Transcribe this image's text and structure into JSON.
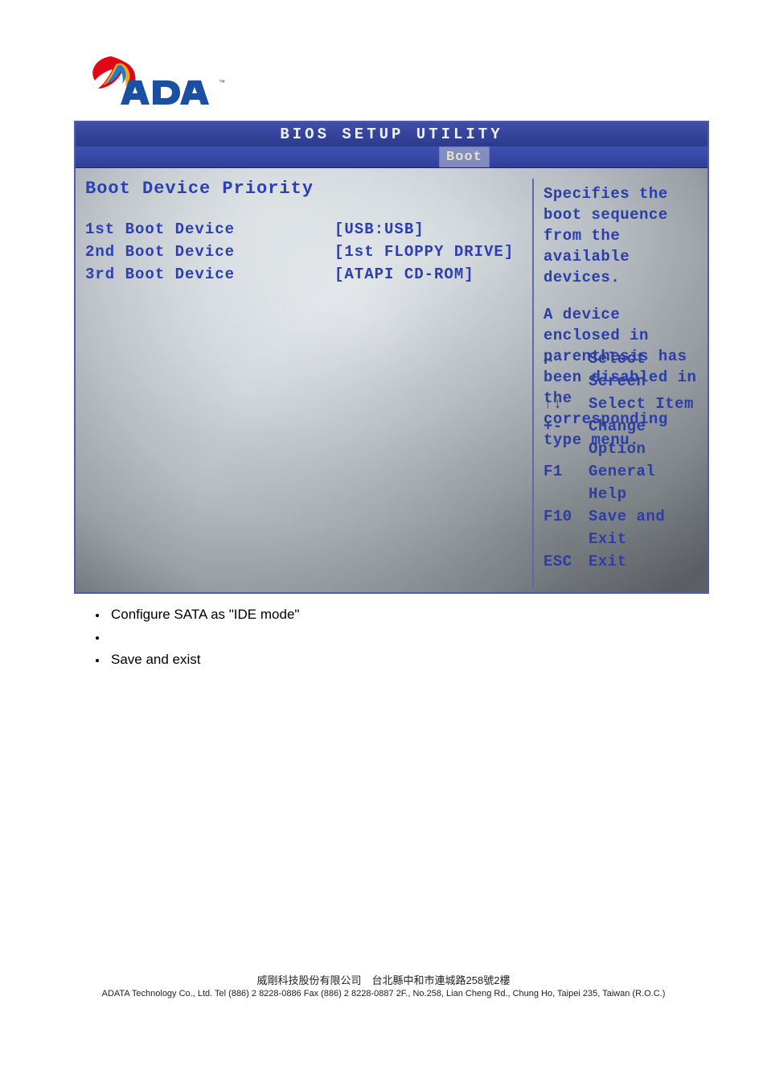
{
  "brand": {
    "name": "ADATA"
  },
  "bios": {
    "title": "BIOS SETUP UTILITY",
    "active_tab": "Boot",
    "panel_title": "Boot Device Priority",
    "boot_items": [
      {
        "label": "1st Boot Device",
        "value": "[USB:USB]"
      },
      {
        "label": "2nd Boot Device",
        "value": "[1st FLOPPY DRIVE]"
      },
      {
        "label": "3rd Boot Device",
        "value": "[ATAPI CD-ROM]"
      }
    ],
    "help": {
      "p1": "Specifies the boot sequence from the available devices.",
      "p2": "A device enclosed in parenthesis has been disabled in the corresponding type menu."
    },
    "keys": [
      {
        "key": "↔",
        "desc": "Select Screen"
      },
      {
        "key": "↑↓",
        "desc": "Select Item"
      },
      {
        "key": "+-",
        "desc": "Change Option"
      },
      {
        "key": "F1",
        "desc": "General Help"
      },
      {
        "key": "F10",
        "desc": "Save and Exit"
      },
      {
        "key": "ESC",
        "desc": "Exit"
      }
    ]
  },
  "doc": {
    "bullets": [
      "Configure SATA as \"IDE mode\"",
      "",
      "Save and exist"
    ],
    "footer_line1": "威剛科技股份有限公司　台北縣中和市連城路258號2樓",
    "footer_line2": "ADATA Technology Co., Ltd.   Tel (886) 2 8228-0886  Fax (886) 2 8228-0887   2F., No.258, Lian Cheng Rd., Chung Ho, Taipei 235, Taiwan (R.O.C.)"
  }
}
